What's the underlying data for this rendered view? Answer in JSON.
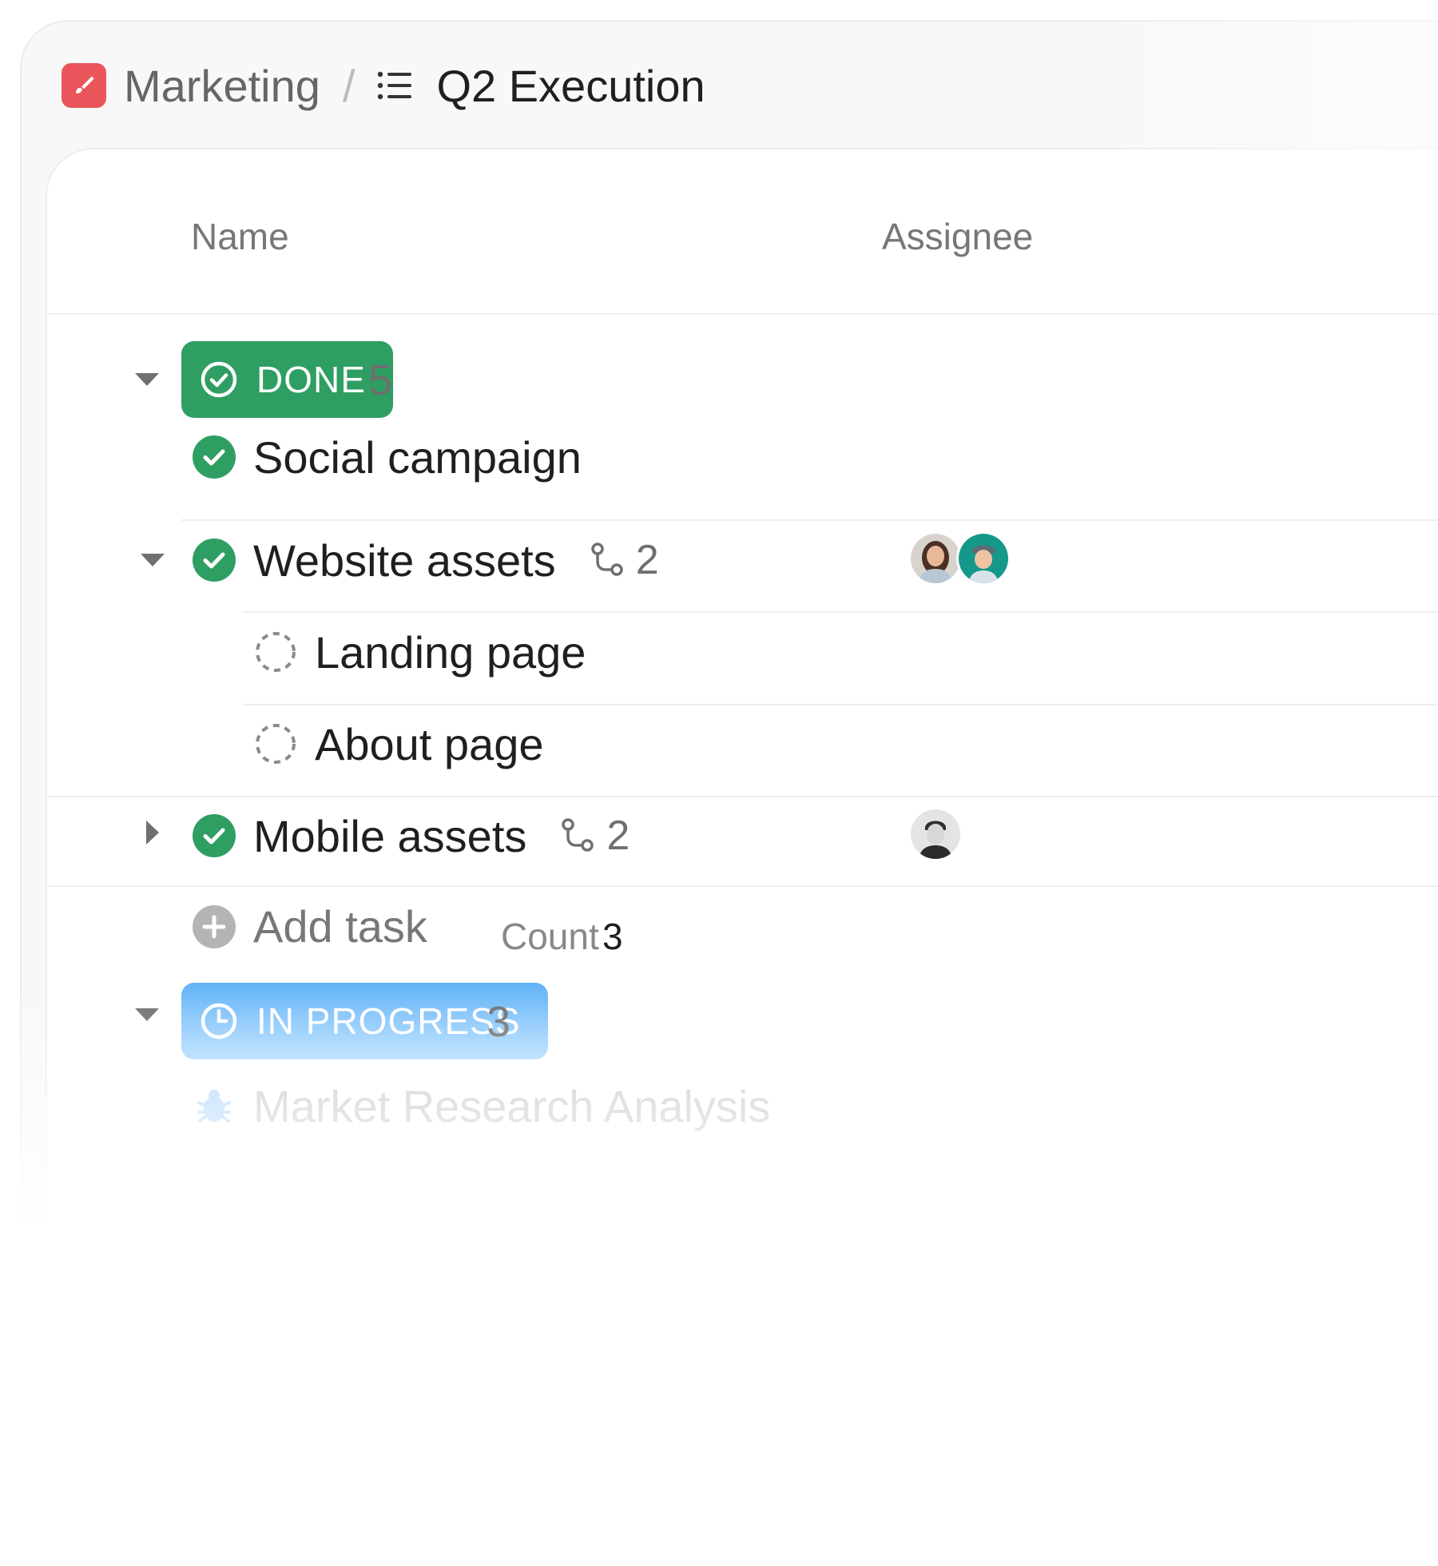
{
  "breadcrumb": {
    "space": "Marketing",
    "separator": "/",
    "list": "Q2 Execution"
  },
  "columns": {
    "name": "Name",
    "assignee": "Assignee"
  },
  "groups": [
    {
      "status": "DONE",
      "count": "5",
      "color": "#2f9e63"
    },
    {
      "status": "IN PROGRESS",
      "count": "3",
      "color": "#63b3f7"
    }
  ],
  "tasks": {
    "social_campaign": {
      "name": "Social campaign",
      "status": "done"
    },
    "website_assets": {
      "name": "Website assets",
      "subtasks": "2",
      "status": "done",
      "expanded": true
    },
    "landing_page": {
      "name": "Landing page",
      "status": "todo"
    },
    "about_page": {
      "name": "About page",
      "status": "todo"
    },
    "mobile_assets": {
      "name": "Mobile assets",
      "subtasks": "2",
      "status": "done",
      "expanded": false
    },
    "market_research": {
      "name": "Market Research Analysis",
      "status": "in-progress"
    }
  },
  "footer": {
    "add_task": "Add task",
    "count_label": "Count",
    "count_value": "3"
  },
  "icons": {
    "app": "paintbrush-icon",
    "list": "list-icon",
    "done": "check-circle-icon",
    "todo": "dashed-circle-icon",
    "in_progress": "clock-icon",
    "subtasks": "subtask-icon",
    "add": "plus-circle-icon",
    "bug": "bug-icon"
  }
}
